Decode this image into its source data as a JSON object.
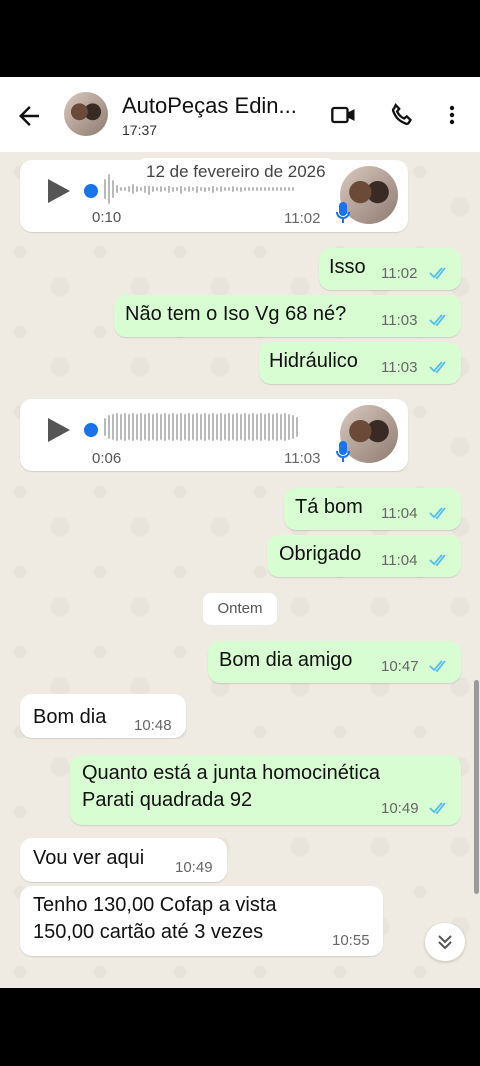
{
  "header": {
    "title": "AutoPeças Edin...",
    "subtitle": "17:37",
    "icons": [
      "back-arrow-icon",
      "video-call-icon",
      "phone-icon",
      "more-vert-icon"
    ]
  },
  "chat": {
    "date_chip": "12 de fevereiro de 2026",
    "day_chip": "Ontem",
    "messages": [
      {
        "kind": "audio",
        "dir": "in",
        "duration": "0:10",
        "time": "11:02"
      },
      {
        "kind": "text",
        "dir": "out",
        "text": "Isso",
        "time": "11:02"
      },
      {
        "kind": "text",
        "dir": "out",
        "text": "Não tem o Iso Vg 68 né?",
        "time": "11:03"
      },
      {
        "kind": "text",
        "dir": "out",
        "text": "Hidráulico",
        "time": "11:03"
      },
      {
        "kind": "audio",
        "dir": "in",
        "duration": "0:06",
        "time": "11:03"
      },
      {
        "kind": "text",
        "dir": "out",
        "text": "Tá bom",
        "time": "11:04"
      },
      {
        "kind": "text",
        "dir": "out",
        "text": "Obrigado",
        "time": "11:04"
      },
      {
        "kind": "text",
        "dir": "out",
        "text": "Bom dia amigo",
        "time": "10:47"
      },
      {
        "kind": "text",
        "dir": "in",
        "text": "Bom dia",
        "time": "10:48"
      },
      {
        "kind": "text",
        "dir": "out",
        "line1": "Quanto está a junta homocinética",
        "line2": "Parati quadrada 92",
        "time": "10:49"
      },
      {
        "kind": "text",
        "dir": "in",
        "text": "Vou ver aqui",
        "time": "10:49"
      },
      {
        "kind": "text",
        "dir": "in",
        "line1": "Tenho 130,00 Cofap a vista",
        "line2": "150,00 cartão até 3 vezes",
        "time": "10:55"
      }
    ]
  },
  "colors": {
    "outgoing": "#d9fdd3",
    "incoming": "#ffffff",
    "read_ticks": "#53bdeb",
    "accent": "#1a73e8",
    "chat_bg": "#efeae2"
  }
}
